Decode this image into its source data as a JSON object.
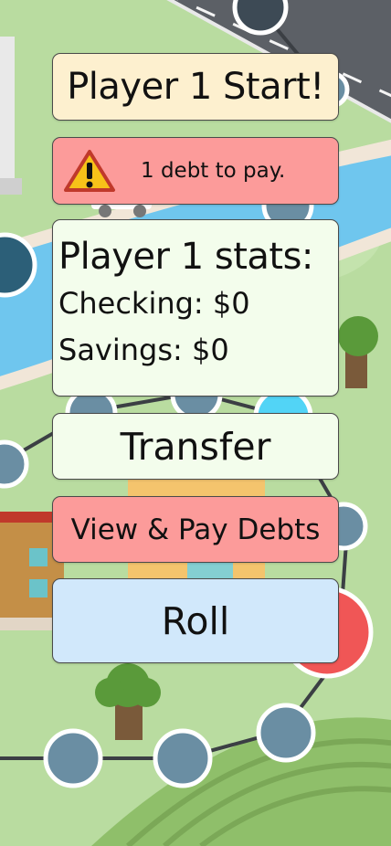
{
  "turn_banner": {
    "text": "Player 1 Start!"
  },
  "debt_alert": {
    "icon": "warning-icon",
    "text": "1 debt to pay."
  },
  "stats": {
    "title": "Player 1 stats:",
    "checking_label": "Checking:",
    "checking_value": "$0",
    "savings_label": "Savings:",
    "savings_value": "$0"
  },
  "buttons": {
    "transfer": "Transfer",
    "view_pay_debts": "View & Pay Debts",
    "roll": "Roll"
  },
  "colors": {
    "banner_bg": "#fdf0cf",
    "alert_bg": "#fc9b9a",
    "stats_bg": "#f3fdec",
    "roll_bg": "#d1e8fb",
    "board_grass": "#b9dca0",
    "river": "#6fc6ee",
    "road": "#5c6066",
    "board_space": "#6a8ea3",
    "red_space": "#f05656",
    "cyan_space": "#52d4f6"
  }
}
